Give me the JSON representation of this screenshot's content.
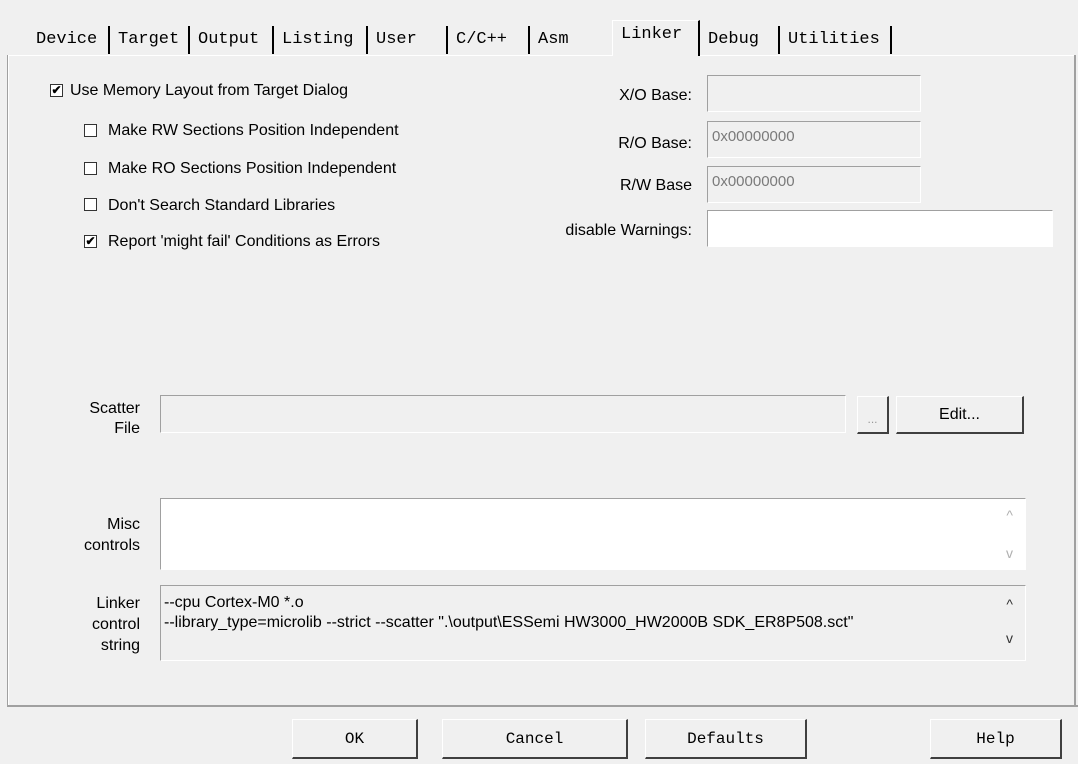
{
  "tabs": [
    {
      "label": "Device"
    },
    {
      "label": "Target"
    },
    {
      "label": "Output"
    },
    {
      "label": "Listing"
    },
    {
      "label": "User"
    },
    {
      "label": "C/C++"
    },
    {
      "label": "Asm"
    },
    {
      "label": "Linker",
      "active": true
    },
    {
      "label": "Debug"
    },
    {
      "label": "Utilities"
    }
  ],
  "options": {
    "use_memory_layout": {
      "label": "Use Memory Layout from Target Dialog",
      "checked": true
    },
    "rw_independent": {
      "label": "Make RW Sections Position Independent",
      "checked": false
    },
    "ro_independent": {
      "label": "Make RO Sections Position Independent",
      "checked": false
    },
    "dont_search_libs": {
      "label": "Don't Search Standard Libraries",
      "checked": false
    },
    "report_might_fail": {
      "label": "Report 'might fail' Conditions as Errors",
      "checked": true
    }
  },
  "fields": {
    "xo_base": {
      "label": "X/O Base:",
      "value": ""
    },
    "ro_base": {
      "label": "R/O Base:",
      "value": "0x00000000"
    },
    "rw_base": {
      "label": "R/W Base",
      "value": "0x00000000"
    },
    "disable_warnings": {
      "label": "disable Warnings:",
      "value": ""
    }
  },
  "scatter": {
    "label_line1": "Scatter",
    "label_line2": "File",
    "value": "",
    "browse_label": "...",
    "edit_label": "Edit..."
  },
  "misc": {
    "label_line1": "Misc",
    "label_line2": "controls",
    "value": ""
  },
  "linker_control": {
    "label_line1": "Linker",
    "label_line2": "control",
    "label_line3": "string",
    "line1": "--cpu Cortex-M0 *.o",
    "line2": "--library_type=microlib --strict --scatter \".\\output\\ESSemi HW3000_HW2000B SDK_ER8P508.sct\""
  },
  "buttons": {
    "ok": "OK",
    "cancel": "Cancel",
    "defaults": "Defaults",
    "help": "Help"
  },
  "check_mark": "✔"
}
